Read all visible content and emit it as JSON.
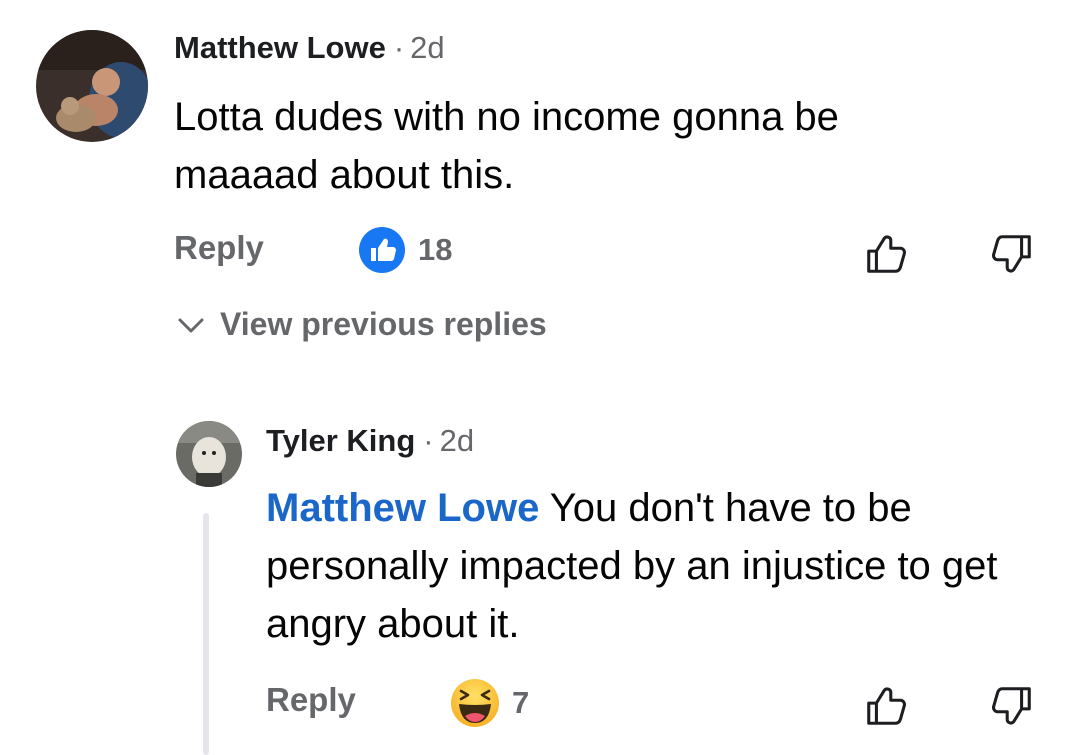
{
  "comments": [
    {
      "author": "Matthew Lowe",
      "time": "2d",
      "text": "Lotta dudes with no income gonna be maaaad about this.",
      "reply_label": "Reply",
      "reaction": {
        "icon": "like-reaction-icon",
        "count": "18",
        "color": "#1877f2"
      }
    },
    {
      "author": "Tyler King",
      "time": "2d",
      "mention": "Matthew Lowe",
      "text": "You don't have to be personally impacted by an injustice to get angry about it.",
      "reply_label": "Reply",
      "reaction": {
        "icon": "haha-reaction-icon",
        "count": "7",
        "color": "#f7b125"
      }
    }
  ],
  "view_previous_label": "View previous replies"
}
